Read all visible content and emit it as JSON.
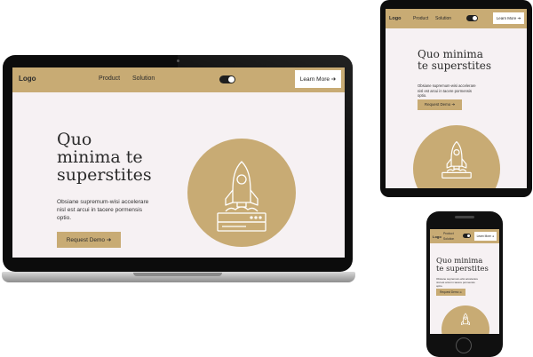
{
  "site": {
    "logo": "Logo",
    "nav_links": [
      "Product",
      "Solution"
    ],
    "nav_links_phone": [
      "Product",
      "Solution"
    ],
    "cta_label": "Learn More ➔",
    "heading": "Quo\nminima te\nsuperstites",
    "heading_tablet": "Quo minima\nte superstites",
    "subtitle": "Obsiane supremum-wisi accelerare\nnisl est arcui in tacere pormensis\noptio.",
    "subtitle_tablet": "Obsiane supremum-wisi accelerare\nnisl est arcui in tacere pormensis\noptio.",
    "button_label": "Request Demo ➔"
  },
  "colors": {
    "accent": "#c8ab74",
    "page_background": "#f6f1f3",
    "device_frame": "#0c0c0c"
  },
  "icons": {
    "hero_illustration": "rocket-launch-icon",
    "toggle": "toggle-switch-icon"
  }
}
